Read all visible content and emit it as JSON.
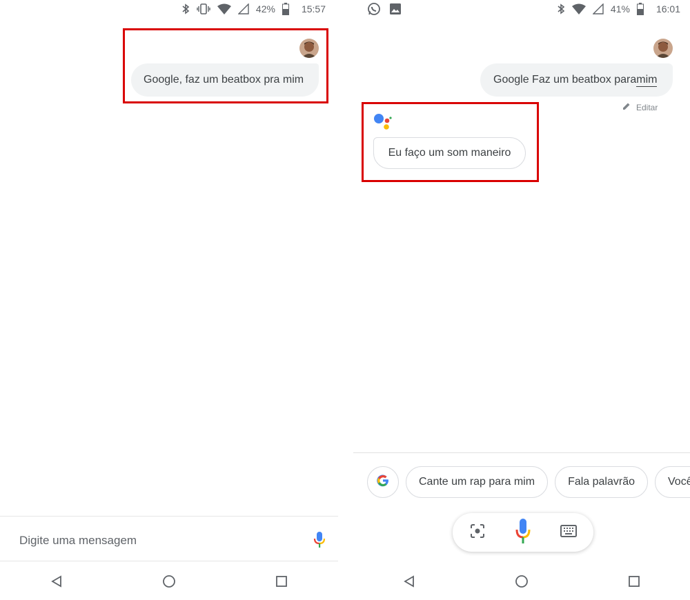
{
  "left": {
    "status": {
      "battery": "42%",
      "time": "15:57"
    },
    "user_message": "Google, faz um beatbox pra mim",
    "input_placeholder": "Digite uma mensagem"
  },
  "right": {
    "status": {
      "battery": "41%",
      "time": "16:01"
    },
    "user_message_main": "Google Faz um beatbox para ",
    "user_message_underlined": "mim",
    "edit_label": "Editar",
    "assistant_message": "Eu faço um som maneiro",
    "chips": [
      "Cante um rap para mim",
      "Fala palavrão",
      "Você"
    ]
  },
  "icons": {
    "status": [
      "bluetooth-icon",
      "vibrate-icon",
      "wifi-icon",
      "signal-icon",
      "battery-icon"
    ],
    "nav": [
      "back-icon",
      "home-icon",
      "recents-icon"
    ]
  },
  "colors": {
    "highlight": "#d90000",
    "bubble": "#f1f3f4",
    "google_blue": "#4285f4",
    "google_red": "#ea4335",
    "google_yellow": "#fbbc05",
    "google_green": "#34a853"
  }
}
